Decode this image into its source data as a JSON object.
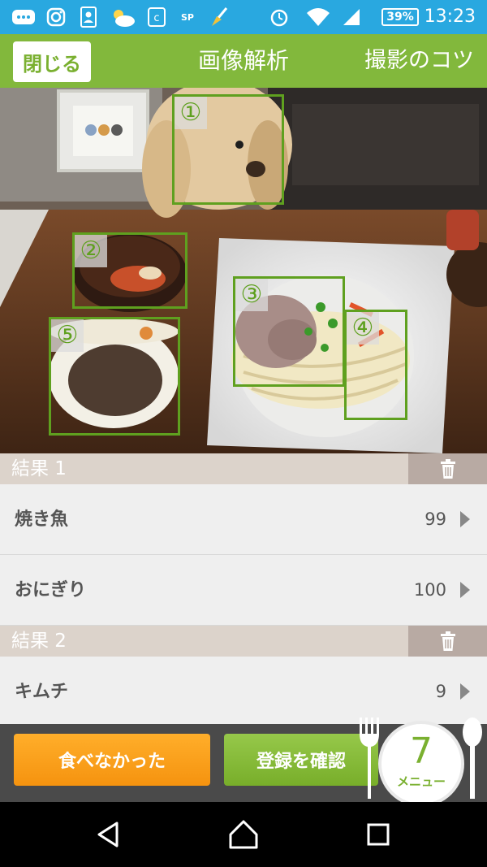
{
  "status_bar": {
    "time": "13:23",
    "battery": "39%",
    "icons": [
      "message-icon",
      "instagram-icon",
      "contacts-icon",
      "weather-icon",
      "c-app-icon",
      "sports-app-icon",
      "broom-icon",
      "alarm-icon",
      "wifi-icon",
      "signal-icon",
      "battery-icon"
    ]
  },
  "header": {
    "close_label": "閉じる",
    "title": "画像解析",
    "tips_label": "撮影のコツ"
  },
  "detections": [
    {
      "label": "①"
    },
    {
      "label": "②"
    },
    {
      "label": "③"
    },
    {
      "label": "④"
    },
    {
      "label": "⑤"
    }
  ],
  "results": [
    {
      "title": "結果 1",
      "items": [
        {
          "name": "焼き魚",
          "score": "99"
        },
        {
          "name": "おにぎり",
          "score": "100"
        }
      ]
    },
    {
      "title": "結果 2",
      "items": [
        {
          "name": "キムチ",
          "score": "9"
        }
      ]
    }
  ],
  "actions": {
    "no_eat_label": "食べなかった",
    "confirm_label": "登録を確認",
    "menu_count": "7",
    "menu_label": "メニュー"
  },
  "colors": {
    "status_bar": "#29a8e0",
    "header": "#82b83c",
    "accent_green": "#7ab030",
    "detection_box": "#5fa01f",
    "orange_button": "#f5930f"
  }
}
